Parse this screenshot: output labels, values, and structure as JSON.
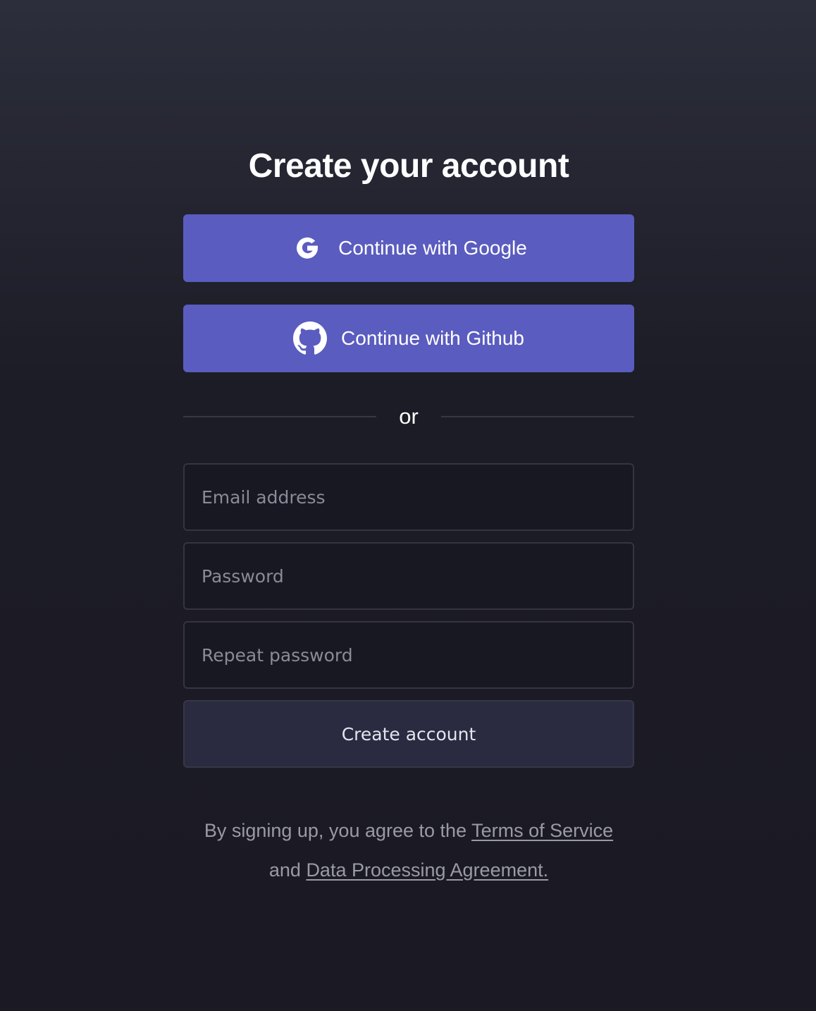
{
  "page": {
    "title": "Create your account"
  },
  "oauth": {
    "google": {
      "label": "Continue with Google",
      "icon": "google-icon"
    },
    "github": {
      "label": "Continue with Github",
      "icon": "github-icon"
    }
  },
  "divider": {
    "text": "or"
  },
  "form": {
    "email_placeholder": "Email address",
    "password_placeholder": "Password",
    "repeat_password_placeholder": "Repeat password",
    "submit_label": "Create account"
  },
  "legal": {
    "prefix": "By signing up, you agree to the ",
    "terms_link": "Terms of Service",
    "middle": "and ",
    "dpa_link": "Data Processing Agreement."
  },
  "colors": {
    "accent": "#5a5cbf",
    "background": "#1c1c26",
    "input_background": "#181822",
    "submit_background": "#2a2b40"
  }
}
